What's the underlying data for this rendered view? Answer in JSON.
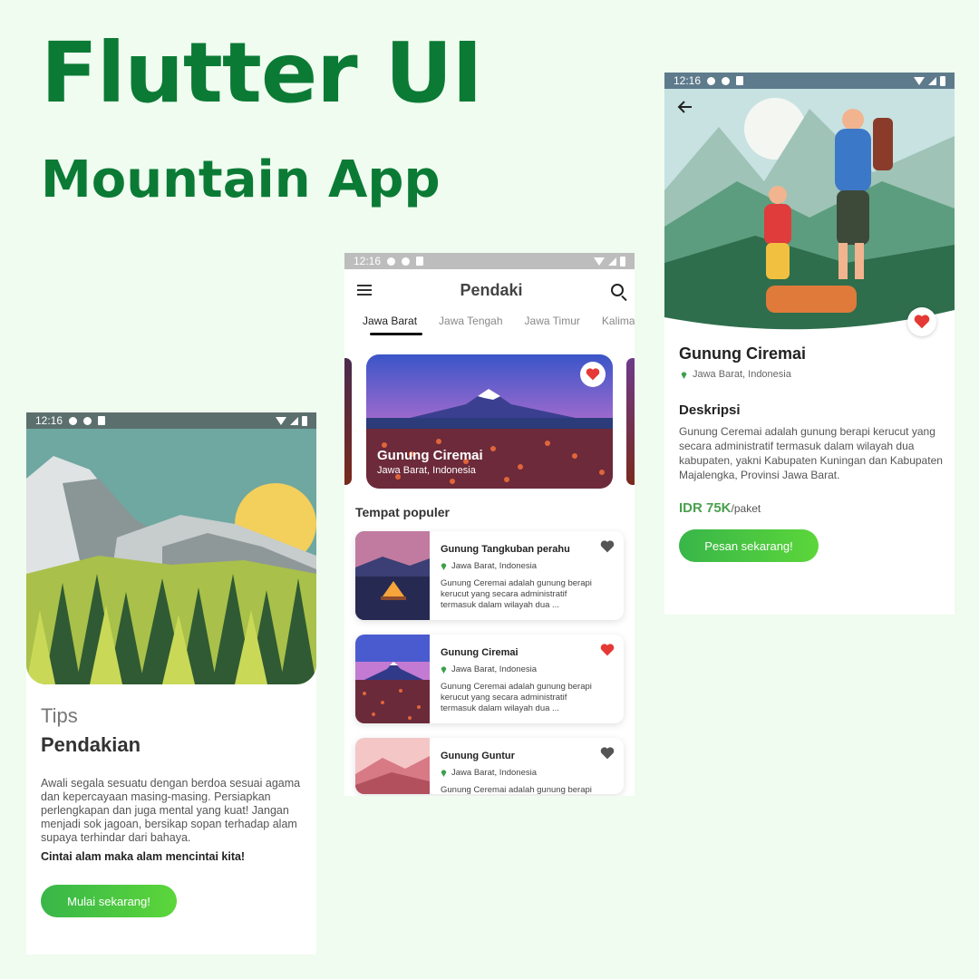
{
  "header": {
    "title": "Flutter UI",
    "subtitle": "Mountain App"
  },
  "statusbar": {
    "time": "12:16"
  },
  "screen1": {
    "tips": "Tips",
    "heading": "Pendakian",
    "paragraph": "Awali segala sesuatu dengan berdoa sesuai agama dan kepercayaan masing-masing. Persiapkan perlengkapan dan juga mental yang kuat! Jangan menjadi sok jagoan, bersikap sopan terhadap alam supaya terhindar dari bahaya.",
    "tagline": "Cintai alam maka alam mencintai kita!",
    "button": "Mulai sekarang!"
  },
  "screen2": {
    "app_title": "Pendaki",
    "tabs": [
      "Jawa Barat",
      "Jawa Tengah",
      "Jawa Timur",
      "Kalimantan"
    ],
    "featured": {
      "name": "Gunung Ciremai",
      "location": "Jawa Barat, Indonesia",
      "favorite": true
    },
    "section_title": "Tempat populer",
    "places": [
      {
        "name": "Gunung Tangkuban perahu",
        "location": "Jawa Barat, Indonesia",
        "description": "Gunung Ceremai adalah gunung berapi kerucut yang secara administratif termasuk dalam wilayah dua ...",
        "favorite": false
      },
      {
        "name": "Gunung Ciremai",
        "location": "Jawa Barat, Indonesia",
        "description": "Gunung Ceremai adalah gunung berapi kerucut yang secara administratif termasuk dalam wilayah dua ...",
        "favorite": true
      },
      {
        "name": "Gunung Guntur",
        "location": "Jawa Barat, Indonesia",
        "description": "Gunung Ceremai adalah gunung berapi",
        "favorite": false
      }
    ]
  },
  "screen3": {
    "name": "Gunung Ciremai",
    "location": "Jawa Barat, Indonesia",
    "desc_heading": "Deskripsi",
    "description": "Gunung Ceremai adalah gunung berapi kerucut yang secara administratif termasuk dalam wilayah dua kabupaten, yakni Kabupaten Kuningan dan Kabupaten Majalengka, Provinsi Jawa Barat.",
    "price": "IDR 75K",
    "price_unit": "/paket",
    "button": "Pesan sekarang!",
    "favorite": true
  },
  "colors": {
    "brand": "#0b7a35",
    "accent": "#4aa04e",
    "favorite": "#e53935",
    "unfavorite": "#555555"
  }
}
